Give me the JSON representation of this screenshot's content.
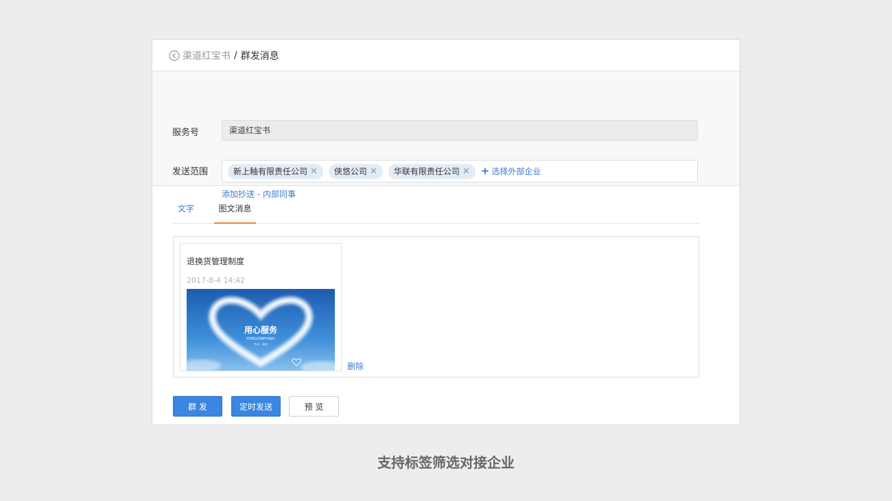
{
  "breadcrumb": {
    "parent": "渠道红宝书",
    "separator": "/",
    "current": "群发消息"
  },
  "form": {
    "service_label": "服务号",
    "service_value": "渠道红宝书",
    "scope_label": "发送范围",
    "scope_tags": [
      "新上釉有限责任公司",
      "侠悠公司",
      "华联有限责任公司"
    ],
    "tag_remove_glyph": "×",
    "add_external_glyph": "+",
    "add_external_label": "选择外部企业",
    "cc_link": "添加抄送 - 内部同事"
  },
  "tabs": [
    {
      "label": "文字",
      "active": false
    },
    {
      "label": "图文消息",
      "active": true
    }
  ],
  "news_card": {
    "title": "退换货管理制度",
    "time": "2017-8-4 14:42",
    "image_title": "用心服务",
    "image_subtitle": "YONGXINFUWU",
    "image_tagline": "专业 · 高效",
    "delete_label": "删除"
  },
  "actions": {
    "send_label": "群 发",
    "schedule_label": "定时发送",
    "preview_label": "预 览"
  },
  "caption": "支持标签筛选对接企业",
  "colors": {
    "link": "#3a7bd5",
    "primary": "#3a86e0",
    "tab_active": "#e8892d"
  }
}
